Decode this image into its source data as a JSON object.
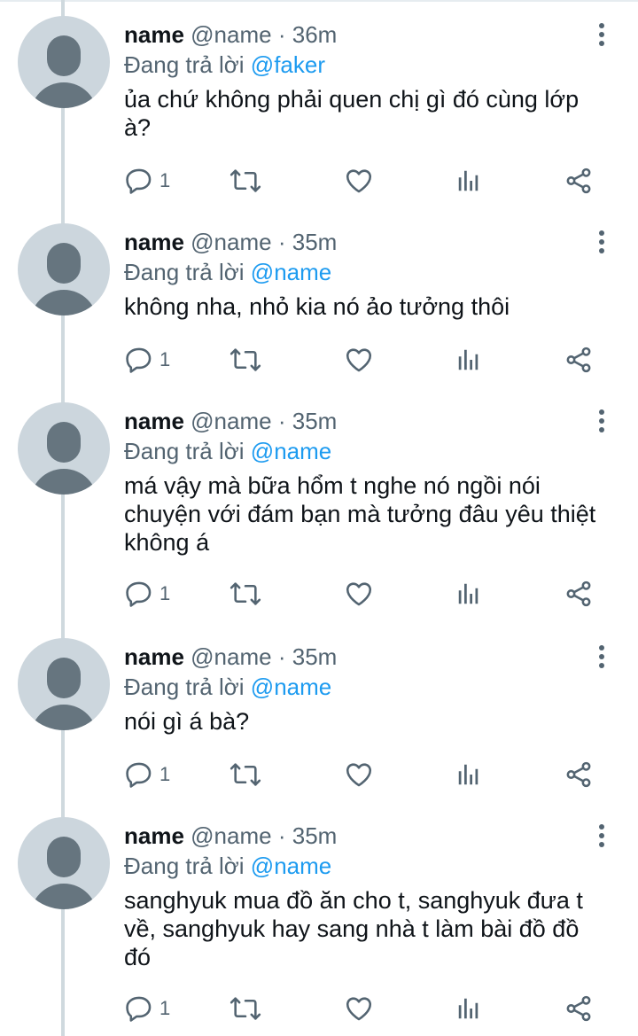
{
  "tweets": [
    {
      "display_name": "name",
      "handle": "@name",
      "time": "36m",
      "reply_prefix": "Đang trả lời",
      "reply_handle": "@faker",
      "text": "ủa chứ không phải quen chị gì đó cùng lớp à?",
      "reply_count": "1"
    },
    {
      "display_name": "name",
      "handle": "@name",
      "time": "35m",
      "reply_prefix": "Đang trả lời",
      "reply_handle": "@name",
      "text": "không nha, nhỏ kia nó ảo tưởng thôi",
      "reply_count": "1"
    },
    {
      "display_name": "name",
      "handle": "@name",
      "time": "35m",
      "reply_prefix": "Đang trả lời",
      "reply_handle": "@name",
      "text": "má vậy mà bữa hổm t nghe nó ngồi nói chuyện với đám bạn mà tưởng đâu yêu thiệt không á",
      "reply_count": "1"
    },
    {
      "display_name": "name",
      "handle": "@name",
      "time": "35m",
      "reply_prefix": "Đang trả lời",
      "reply_handle": "@name",
      "text": "nói gì á bà?",
      "reply_count": "1"
    },
    {
      "display_name": "name",
      "handle": "@name",
      "time": "35m",
      "reply_prefix": "Đang trả lời",
      "reply_handle": "@name",
      "text": "sanghyuk mua đồ ăn cho t, sanghyuk đưa t về, sanghyuk hay sang nhà t làm bài đồ đồ đó",
      "reply_count": "1"
    }
  ],
  "icons": {
    "reply": "reply-icon",
    "retweet": "retweet-icon",
    "like": "heart-icon",
    "analytics": "analytics-icon",
    "share": "share-icon",
    "more": "more-icon"
  },
  "colors": {
    "link": "#1d9bf0",
    "muted": "#536471",
    "text": "#0f1419",
    "avatar_bg": "#ccd6dd",
    "avatar_fg": "#66757f",
    "thread_line": "#cfd9de"
  }
}
